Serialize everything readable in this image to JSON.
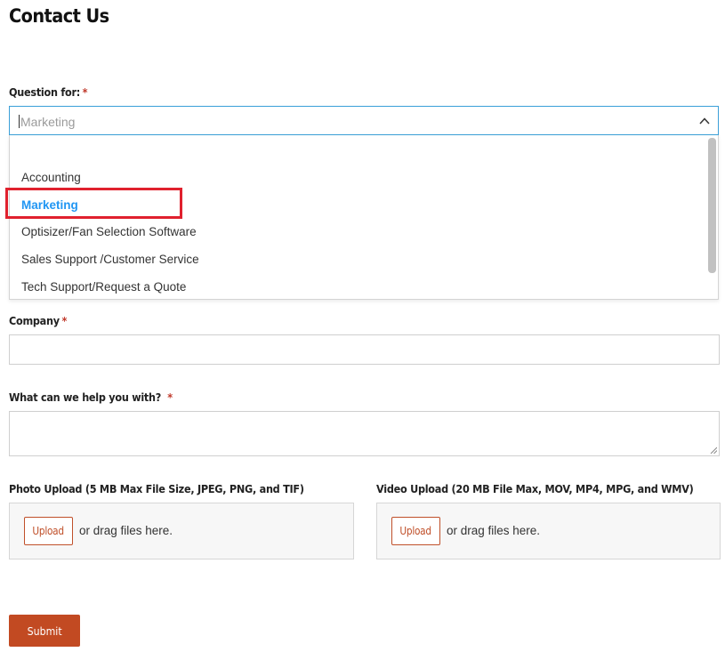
{
  "page": {
    "title": "Contact Us"
  },
  "question": {
    "label": "Question for:",
    "required_mark": "*",
    "current_value": "Marketing",
    "options": [
      {
        "label": "Accounting",
        "selected": false
      },
      {
        "label": "Marketing",
        "selected": true
      },
      {
        "label": "Optisizer/Fan Selection Software",
        "selected": false
      },
      {
        "label": "Sales Support /Customer Service",
        "selected": false
      },
      {
        "label": "Tech Support/Request a Quote",
        "selected": false
      }
    ]
  },
  "company": {
    "label": "Company",
    "required_mark": "*",
    "value": ""
  },
  "help": {
    "label": "What can we help you with?",
    "required_mark": "*",
    "value": ""
  },
  "photo_upload": {
    "label": "Photo Upload (5 MB Max File Size, JPEG, PNG, and TIF)",
    "button_label": "Upload",
    "drag_text": "or drag files here."
  },
  "video_upload": {
    "label": "Video Upload (20 MB File Max, MOV, MP4, MPG, and WMV)",
    "button_label": "Upload",
    "drag_text": "or drag files here."
  },
  "submit": {
    "label": "Submit"
  },
  "colors": {
    "accent_blue": "#3a9fd8",
    "selected_option": "#2196f3",
    "highlight_red": "#e0212e",
    "submit_bg": "#c24a22",
    "required": "#c0392b"
  }
}
